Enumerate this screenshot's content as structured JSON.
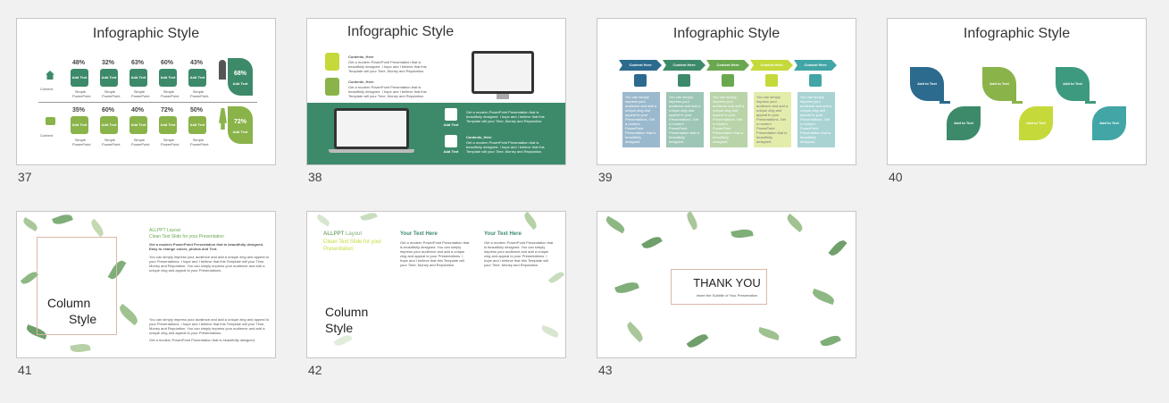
{
  "slides": [
    {
      "number": "37",
      "title": "Infographic Style",
      "row1": {
        "percents": [
          "48%",
          "32%",
          "63%",
          "60%",
          "43%"
        ],
        "label": "Content",
        "big_pct": "68%",
        "big_label": "Add Text"
      },
      "row2": {
        "percents": [
          "35%",
          "60%",
          "40%",
          "72%",
          "50%"
        ],
        "label": "Content",
        "big_pct": "72%",
        "big_label": "Add Text"
      },
      "badge_label": "Add Text",
      "caption": "Simple PowerPoint"
    },
    {
      "number": "38",
      "title": "Infographic Style",
      "item_title": "Contents_Here",
      "item_body": "Get a modern PowerPoint Presentation that is beautifully designed. I hope and I believe that this Template will your Time, Money and Reputation.",
      "icon_label": "Add Text"
    },
    {
      "number": "39",
      "title": "Infographic Style",
      "arrow_label": "Content Here",
      "card_body": "You can simply impress your audience and add a unique zing and appeal to your Presentations. Get a modern PowerPoint Presentation that is beautifully designed."
    },
    {
      "number": "40",
      "title": "Infographic Style",
      "leaf_label": "Add to Text"
    },
    {
      "number": "41",
      "title_left": "Column",
      "title_left2": "Style",
      "layout_title": "ALLPPT Layout",
      "layout_sub": "Clean Text Slide for your Presentation",
      "lead": "Get a modern PowerPoint Presentation that is beautifully designed. Easy to change colors, photos and Text.",
      "body": "You can simply impress your audience and add a unique zing and appeal to your Presentations. I hope and I believe that this Template will your Time, Money and Reputation. You can simply impress your audience and add a unique zing and appeal to your Presentations.",
      "foot": "Get a modern PowerPoint Presentation that is beautifully designed."
    },
    {
      "number": "42",
      "title_left": "Column",
      "title_left2": "Style",
      "layout_title": "ALLPPT",
      "layout_title2": "Layout",
      "layout_sub": "Clean Text Slide for your Presentation",
      "col_head": "Your Text Here",
      "col_body": "Get a modern PowerPoint Presentation that is beautifully designed. You can simply impress your audience and add a unique zing and appeal to your Presentations. I hope and I believe that this Template will your Time, Money and Reputation."
    },
    {
      "number": "43",
      "title": "THANK YOU",
      "subtitle": "Insert the Subtitle of Your Presentation"
    }
  ],
  "colors": {
    "green_dark": "#3d8a6b",
    "green_mid": "#6aa84f",
    "green_lime": "#c6d93a",
    "teal": "#42a5a6",
    "navy": "#2c6a8e",
    "bg": "#f1f1f1"
  }
}
